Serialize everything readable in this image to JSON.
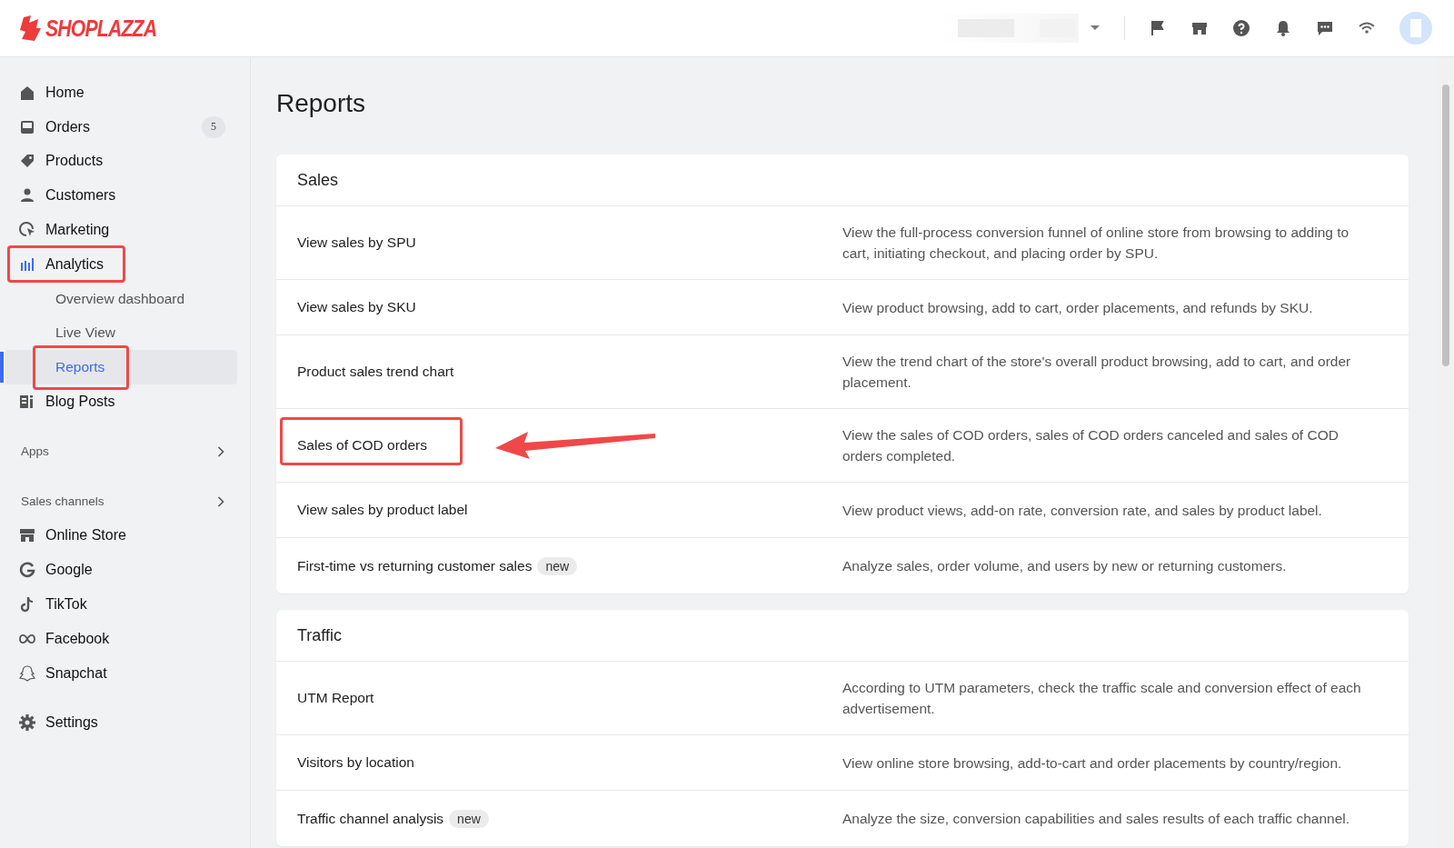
{
  "logo": {
    "text": "SHOPLAZZA"
  },
  "sidebar": {
    "items": [
      {
        "kind": "item",
        "label": "Home",
        "active": false,
        "annotated": false
      },
      {
        "kind": "item",
        "label": "Orders",
        "badge": "5",
        "active": false,
        "annotated": false
      },
      {
        "kind": "item",
        "label": "Products",
        "active": false,
        "annotated": false
      },
      {
        "kind": "item",
        "label": "Customers",
        "active": false,
        "annotated": false
      },
      {
        "kind": "item",
        "label": "Marketing",
        "active": false,
        "annotated": false
      },
      {
        "kind": "item",
        "label": "Analytics",
        "active": true,
        "annotated": true
      },
      {
        "kind": "sub",
        "label": "Overview dashboard",
        "selected": false,
        "annotated": false
      },
      {
        "kind": "sub",
        "label": "Live View",
        "selected": false,
        "annotated": false
      },
      {
        "kind": "sub",
        "label": "Reports",
        "selected": true,
        "annotated": true
      },
      {
        "kind": "item",
        "label": "Blog Posts",
        "active": false,
        "annotated": false
      },
      {
        "kind": "section",
        "label": "Apps"
      },
      {
        "kind": "section",
        "label": "Sales channels"
      },
      {
        "kind": "item",
        "label": "Online Store",
        "active": false,
        "annotated": false
      },
      {
        "kind": "item",
        "label": "Google",
        "active": false,
        "annotated": false
      },
      {
        "kind": "item",
        "label": "TikTok",
        "active": false,
        "annotated": false
      },
      {
        "kind": "item",
        "label": "Facebook",
        "active": false,
        "annotated": false
      },
      {
        "kind": "item",
        "label": "Snapchat",
        "active": false,
        "annotated": false
      },
      {
        "kind": "gap"
      },
      {
        "kind": "item",
        "label": "Settings",
        "active": false,
        "annotated": false
      }
    ]
  },
  "page": {
    "title": "Reports"
  },
  "sections": [
    {
      "title": "Sales",
      "rows": [
        {
          "name": "View sales by SPU",
          "description": "View the full-process conversion funnel of online store from browsing to adding to cart, initiating checkout, and placing order by SPU.",
          "annotated": false
        },
        {
          "name": "View sales by SKU",
          "description": "View product browsing, add to cart, order placements, and refunds by SKU.",
          "annotated": false
        },
        {
          "name": "Product sales trend chart",
          "description": "View the trend chart of the store's overall product browsing, add to cart, and order placement.",
          "annotated": false
        },
        {
          "name": "Sales of COD orders",
          "description": "View the sales of COD orders, sales of COD orders canceled and sales of COD orders completed.",
          "annotated": true
        },
        {
          "name": "View sales by product label",
          "description": "View product views, add-on rate, conversion rate, and sales by product label.",
          "annotated": false
        },
        {
          "name": "First-time vs returning customer sales",
          "badge": "new",
          "description": "Analyze sales, order volume, and users by new or returning customers.",
          "annotated": false
        }
      ]
    },
    {
      "title": "Traffic",
      "rows": [
        {
          "name": "UTM Report",
          "description": "According to UTM parameters, check the traffic scale and conversion effect of each advertisement.",
          "annotated": false
        },
        {
          "name": "Visitors by location",
          "description": "View online store browsing, add-to-cart and order placements by country/region.",
          "annotated": false
        },
        {
          "name": "Traffic channel analysis",
          "badge": "new",
          "description": "Analyze the size, conversion capabilities and sales results of each traffic channel.",
          "annotated": false
        }
      ]
    }
  ]
}
